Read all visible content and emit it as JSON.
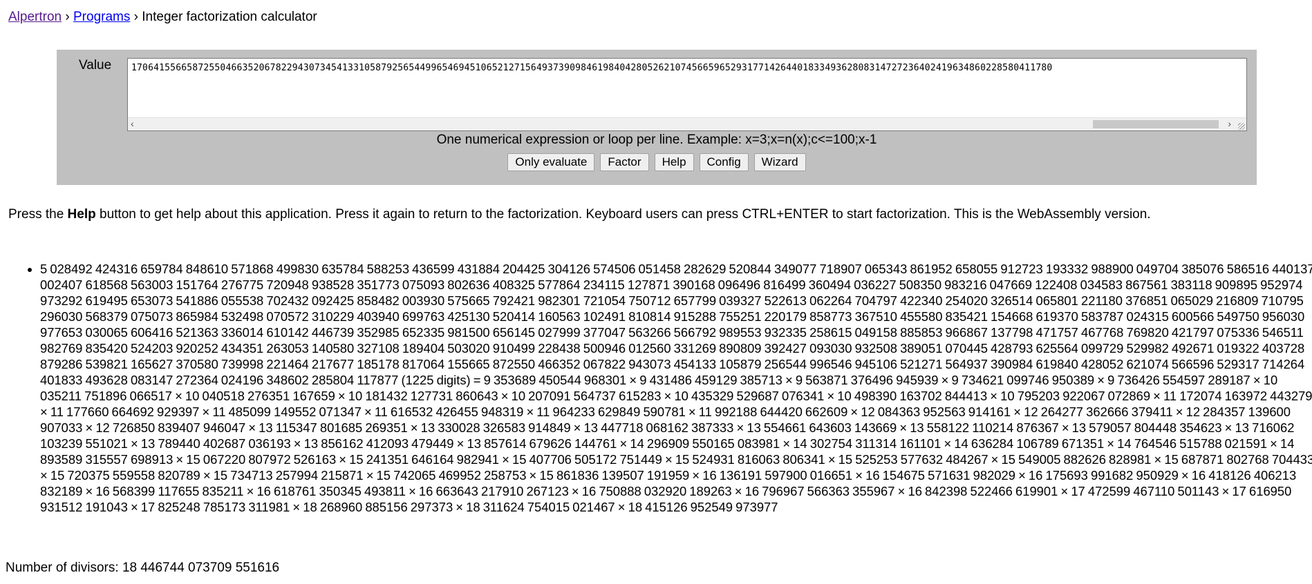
{
  "breadcrumb": {
    "home": "Alpertron",
    "programs": "Programs",
    "current": "Integer factorization calculator",
    "separator": "›"
  },
  "calculator": {
    "value_label": "Value",
    "input_value": "1706415566587255046635206782294307345413310587925654499654694510652127156493739098461984042805262107456659652931771426440183349362808314727236402419634860228580411780",
    "hint": "One numerical expression or loop per line. Example: x=3;x=n(x);c<=100;x-1",
    "buttons": {
      "only_evaluate": "Only evaluate",
      "factor": "Factor",
      "help": "Help",
      "config": "Config",
      "wizard": "Wizard"
    }
  },
  "help_text": {
    "prefix": "Press the ",
    "bold": "Help",
    "suffix": " button to get help about this application. Press it again to return to the factorization. Keyboard users can press CTRL+ENTER to start factorization. This is the WebAssembly version."
  },
  "result": {
    "factorization": "5 028492 424316 659784 848610 571868 499830 635784 588253 436599 431884 204425 304126 574506 051458 282629 520844 349077 718907 065343 861952 658055 912723 193332 988900 049704 385076 586516 440137 002407 618568 563003 151764 276775 720948 938528 351773 075093 802636 408325 577864 234115 127871 390168 096496 816499 360494 036227 508350 983216 047669 122408 034583 867561 383118 909895 952974 973292 619495 653073 541886 055538 702432 092425 858482 003930 575665 792421 982301 721054 750712 657799 039327 522613 062264 704797 422340 254020 326514 065801 221180 376851 065029 216809 710795 296030 568379 075073 865984 532498 070572 310229 403940 699763 425130 520414 160563 102491 810814 915288 755251 220179 858773 367510 455580 835421 154668 619370 583787 024315 600566 549750 956030 977653 030065 606416 521363 336014 610142 446739 352985 652335 981500 656145 027999 377047 563266 566792 989553 932335 258615 049158 885853 966867 137798 471757 467768 769820 421797 075336 546511 982769 835420 524203 920252 434351 263053 140580 327108 189404 503020 910499 228438 500946 012560 331269 890809 392427 093030 932508 389051 070445 428793 625564 099729 529982 492671 019322 403728 879286 539821 165627 370580 739998 221464 217677 185178 817064 155665 872550 466352 067822 943073 454133 105879 256544 996546 945106 521271 564937 390984 619840 428052 621074 566596 529317 714264 401833 493628 083147 272364 024196 348602 285804 117877 (1225 digits) = 9 353689 450544 968301 × 9 431486 459129 385713 × 9 563871 376496 945939 × 9 734621 099746 950389 × 9 736426 554597 289187 × 10 035211 751896 066517 × 10 040518 276351 167659 × 10 181432 127731 860643 × 10 207091 564737 615283 × 10 435329 529687 076341 × 10 498390 163702 844413 × 10 795203 922067 072869 × 11 172074 163972 443279 × 11 177660 664692 929397 × 11 485099 149552 071347 × 11 616532 426455 948319 × 11 964233 629849 590781 × 11 992188 644420 662609 × 12 084363 952563 914161 × 12 264277 362666 379411 × 12 284357 139600 907033 × 12 726850 839407 946047 × 13 115347 801685 269351 × 13 330028 326583 914849 × 13 447718 068162 387333 × 13 554661 643603 143669 × 13 558122 110214 876367 × 13 579057 804448 354623 × 13 716062 103239 551021 × 13 789440 402687 036193 × 13 856162 412093 479449 × 13 857614 679626 144761 × 14 296909 550165 083981 × 14 302754 311314 161101 × 14 636284 106789 671351 × 14 764546 515788 021591 × 14 893589 315557 698913 × 15 067220 807972 526163 × 15 241351 646164 982941 × 15 407706 505172 751449 × 15 524931 816063 806341 × 15 525253 577632 484267 × 15 549005 882626 828981 × 15 687871 802768 704433 × 15 720375 559558 820789 × 15 734713 257994 215871 × 15 742065 469952 258753 × 15 861836 139507 191959 × 16 136191 597900 016651 × 16 154675 571631 982029 × 16 175693 991682 950929 × 16 418126 406213 832189 × 16 568399 117655 835211 × 16 618761 350345 493811 × 16 663643 217910 267123 × 16 750888 032920 189263 × 16 796967 566363 355967 × 16 842398 522466 619901 × 17 472599 467110 501143 × 17 616950 931512 191043 × 17 825248 785173 311981 × 18 268960 885156 297373 × 18 311624 754015 021467 × 18 415126 952549 973977",
    "divisors": "Number of divisors: 18 446744 073709 551616"
  }
}
